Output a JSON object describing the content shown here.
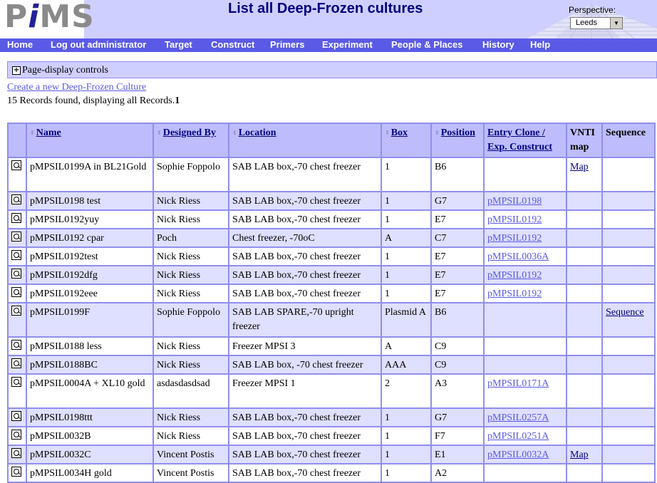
{
  "app": {
    "logo": "PiMS",
    "logo_a": "P",
    "logo_i": "i",
    "logo_b": "MS"
  },
  "header": {
    "title": "List all Deep-Frozen cultures",
    "perspective_label": "Perspective:",
    "perspective_value": "Leeds"
  },
  "nav": {
    "items": [
      "Home",
      "Log out administrator",
      "Target",
      "Construct",
      "Primers",
      "Experiment",
      "People & Places",
      "History",
      "Help"
    ]
  },
  "controls": {
    "label": "Page-display controls"
  },
  "create_link": "Create a new Deep-Frozen Culture",
  "records": {
    "text": "15 Records found, displaying all Records.",
    "page": "1"
  },
  "table": {
    "headers": {
      "name": "Name",
      "designed_by": "Designed By",
      "location": "Location",
      "box": "Box",
      "position": "Position",
      "entry_clone": "Entry Clone / Exp. Construct",
      "vnti": "VNTI map",
      "sequence": "Sequence"
    },
    "rows": [
      {
        "name": "pMPSIL0199A in BL21Gold",
        "designed_by": "Sophie Foppolo",
        "location": "SAB LAB box,-70 chest freezer",
        "box": "1",
        "position": "B6",
        "entry": "",
        "vnti": "Map",
        "sequence": ""
      },
      {
        "name": "pMPSIL0198 test",
        "designed_by": "Nick Riess",
        "location": "SAB LAB box,-70 chest freezer",
        "box": "1",
        "position": "G7",
        "entry": "pMPSIL0198",
        "vnti": "",
        "sequence": ""
      },
      {
        "name": "pMPSIL0192yuy",
        "designed_by": "Nick Riess",
        "location": "SAB LAB box,-70 chest freezer",
        "box": "1",
        "position": "E7",
        "entry": "pMPSIL0192",
        "vnti": "",
        "sequence": ""
      },
      {
        "name": "pMPSIL0192 cpar",
        "designed_by": "Poch",
        "location": "Chest freezer, -70oC",
        "box": "A",
        "position": "C7",
        "entry": "pMPSIL0192",
        "vnti": "",
        "sequence": ""
      },
      {
        "name": "pMPSIL0192test",
        "designed_by": "Nick Riess",
        "location": "SAB LAB box,-70 chest freezer",
        "box": "1",
        "position": "E7",
        "entry": "pMPSIL0036A",
        "vnti": "",
        "sequence": ""
      },
      {
        "name": "pMPSIL0192dfg",
        "designed_by": "Nick Riess",
        "location": "SAB LAB box,-70 chest freezer",
        "box": "1",
        "position": "E7",
        "entry": "pMPSIL0192",
        "vnti": "",
        "sequence": ""
      },
      {
        "name": "pMPSIL0192eee",
        "designed_by": "Nick Riess",
        "location": "SAB LAB box,-70 chest freezer",
        "box": "1",
        "position": "E7",
        "entry": "pMPSIL0192",
        "vnti": "",
        "sequence": ""
      },
      {
        "name": "pMPSIL0199F",
        "designed_by": "Sophie Foppolo",
        "location": "SAB LAB SPARE,-70 upright freezer",
        "box": "Plasmid A",
        "position": "B6",
        "entry": "",
        "vnti": "",
        "sequence": "Sequence"
      },
      {
        "name": "pMPSIL0188 less",
        "designed_by": "Nick Riess",
        "location": "Freezer MPSI 3",
        "box": "A",
        "position": "C9",
        "entry": "",
        "vnti": "",
        "sequence": ""
      },
      {
        "name": "pMPSIL0188BC",
        "designed_by": "Nick Riess",
        "location": "SAB LAB box, -70 chest freezer",
        "box": "AAA",
        "position": "C9",
        "entry": "",
        "vnti": "",
        "sequence": ""
      },
      {
        "name": "pMPSIL0004A + XL10 gold",
        "designed_by": "asdasdasdsad",
        "location": "Freezer MPSI 1",
        "box": "2",
        "position": "A3",
        "entry": "pMPSIL0171A",
        "vnti": "",
        "sequence": ""
      },
      {
        "name": "pMPSIL0198ttt",
        "designed_by": "Nick Riess",
        "location": "SAB LAB box,-70 chest freezer",
        "box": "1",
        "position": "G7",
        "entry": "pMPSIL0257A",
        "vnti": "",
        "sequence": ""
      },
      {
        "name": "pMPSIL0032B",
        "designed_by": "Nick Riess",
        "location": "SAB LAB box,-70 chest freezer",
        "box": "1",
        "position": "F7",
        "entry": "pMPSIL0251A",
        "vnti": "",
        "sequence": ""
      },
      {
        "name": "pMPSIL0032C",
        "designed_by": "Vincent Postis",
        "location": "SAB LAB box,-70 chest freezer",
        "box": "1",
        "position": "E1",
        "entry": "pMPSIL0032A",
        "vnti": "Map",
        "sequence": ""
      },
      {
        "name": "pMPSIL0034H gold",
        "designed_by": "Vincent Postis",
        "location": "SAB LAB box,-70 chest freezer",
        "box": "1",
        "position": "A2",
        "entry": "",
        "vnti": "",
        "sequence": ""
      }
    ]
  }
}
